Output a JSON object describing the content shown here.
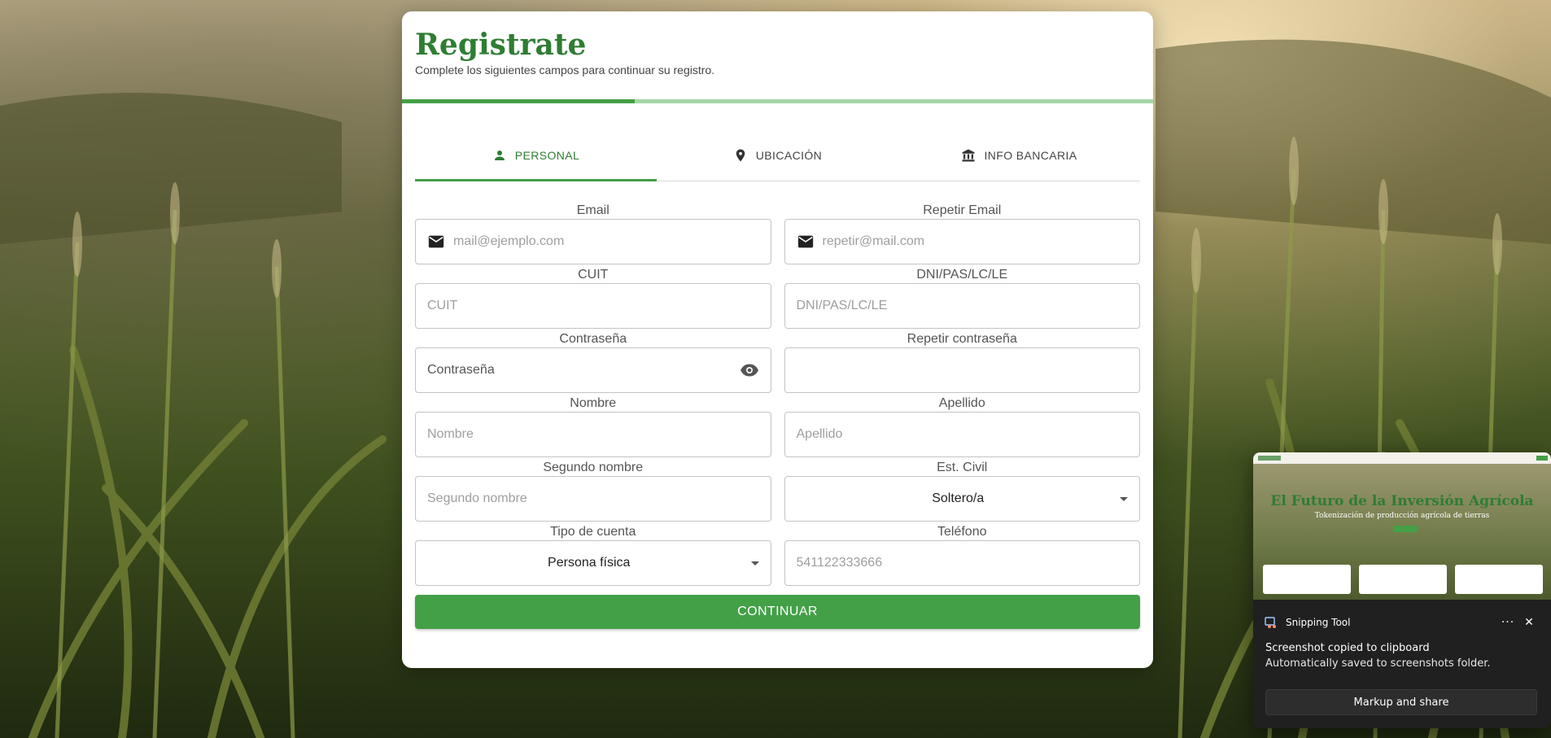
{
  "colors": {
    "brand_green": "#2e7d32",
    "button_green": "#43a047",
    "progress_track": "#a5d6a7"
  },
  "header": {
    "title": "Registrate",
    "subtitle": "Complete los siguientes campos para continuar su registro.",
    "progress_fraction": 0.31
  },
  "tabs": [
    {
      "label": "PERSONAL",
      "icon": "person-icon",
      "active": true
    },
    {
      "label": "UBICACIÓN",
      "icon": "location-pin-icon",
      "active": false
    },
    {
      "label": "INFO BANCARIA",
      "icon": "bank-icon",
      "active": false
    }
  ],
  "form": {
    "email": {
      "label": "Email",
      "placeholder": "mail@ejemplo.com",
      "icon": "mail-icon"
    },
    "repeat_email": {
      "label": "Repetir Email",
      "placeholder": "repetir@mail.com",
      "icon": "mail-icon"
    },
    "cuit": {
      "label": "CUIT",
      "placeholder": "CUIT"
    },
    "dni": {
      "label": "DNI/PAS/LC/LE",
      "placeholder": "DNI/PAS/LC/LE"
    },
    "password": {
      "label": "Contraseña",
      "value": "Contraseña",
      "icon": "eye-icon"
    },
    "repeat_password": {
      "label": "Repetir contraseña",
      "value": ""
    },
    "first_name": {
      "label": "Nombre",
      "placeholder": "Nombre"
    },
    "last_name": {
      "label": "Apellido",
      "placeholder": "Apellido"
    },
    "middle_name": {
      "label": "Segundo nombre",
      "placeholder": "Segundo nombre"
    },
    "civil_status": {
      "label": "Est. Civil",
      "value": "Soltero/a"
    },
    "account_type": {
      "label": "Tipo de cuenta",
      "value": "Persona física"
    },
    "phone": {
      "label": "Teléfono",
      "placeholder": "541122333666"
    },
    "continue_label": "CONTINUAR"
  },
  "toast": {
    "preview": {
      "title": "El Futuro de la Inversión Agrícola",
      "subtitle": "Tokenización de producción agrícola de tierras"
    },
    "app_name": "Snipping Tool",
    "more_label": "···",
    "close_label": "✕",
    "message": "Screenshot copied to clipboard",
    "detail": "Automatically saved to screenshots folder.",
    "action_label": "Markup and share"
  }
}
